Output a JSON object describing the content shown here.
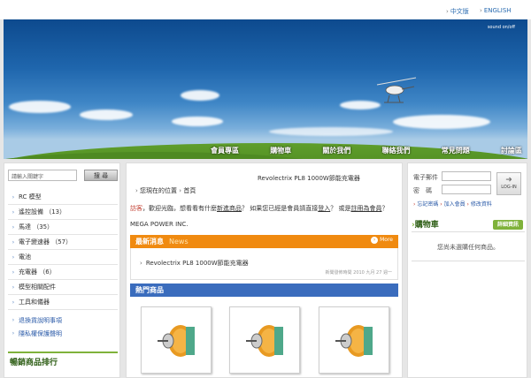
{
  "lang": {
    "zh": "中文版",
    "en": "ENGLISH"
  },
  "banner": {
    "sound": "sound on/off"
  },
  "nav": [
    "會員專區",
    "購物車",
    "關於我們",
    "聯絡我們",
    "常見問題",
    "討論區"
  ],
  "search": {
    "placeholder": "請輸入關鍵字",
    "button": "搜 尋"
  },
  "categories": [
    "RC 模型",
    "遙控設備 （13）",
    "馬達 （35）",
    "電子變速器 （57）",
    "電池",
    "充電器 （6）",
    "模型相關配件",
    "工具和儀器"
  ],
  "links": [
    "退換貨說明事項",
    "隱私權保護聲明"
  ],
  "best_title": "暢銷商品排行",
  "page_title": "Revolectrix PL8 1000W節能充電器",
  "breadcrumb": {
    "here": "您現在的位置",
    "home": "首頁"
  },
  "welcome": {
    "guest": "訪客",
    "t1": "，歡迎光臨，想看看有什麼",
    "new_products": "新進商品",
    "t2": "？ 如果您已經是會員請直接",
    "login": "登入",
    "t3": "？ 或是",
    "register": "註冊為會員",
    "t4": "？"
  },
  "company": "MEGA POWER INC.",
  "news": {
    "title": "最新消息",
    "en": "News",
    "more": "More",
    "item": "Revolectrix PL8 1000W節能充電器",
    "date": "新聞發佈時間 2010 九月 27 週一"
  },
  "hot_title": "熱門商品",
  "login": {
    "email_label": "電子郵件",
    "pwd_label": "密　碼",
    "btn": "LOG-IN",
    "forgot": "忘記密碼",
    "join": "加入會員",
    "edit": "修改資料"
  },
  "cart": {
    "title": "購物車",
    "detail": "詳細資訊",
    "empty": "您尚未選購任何商品。"
  }
}
